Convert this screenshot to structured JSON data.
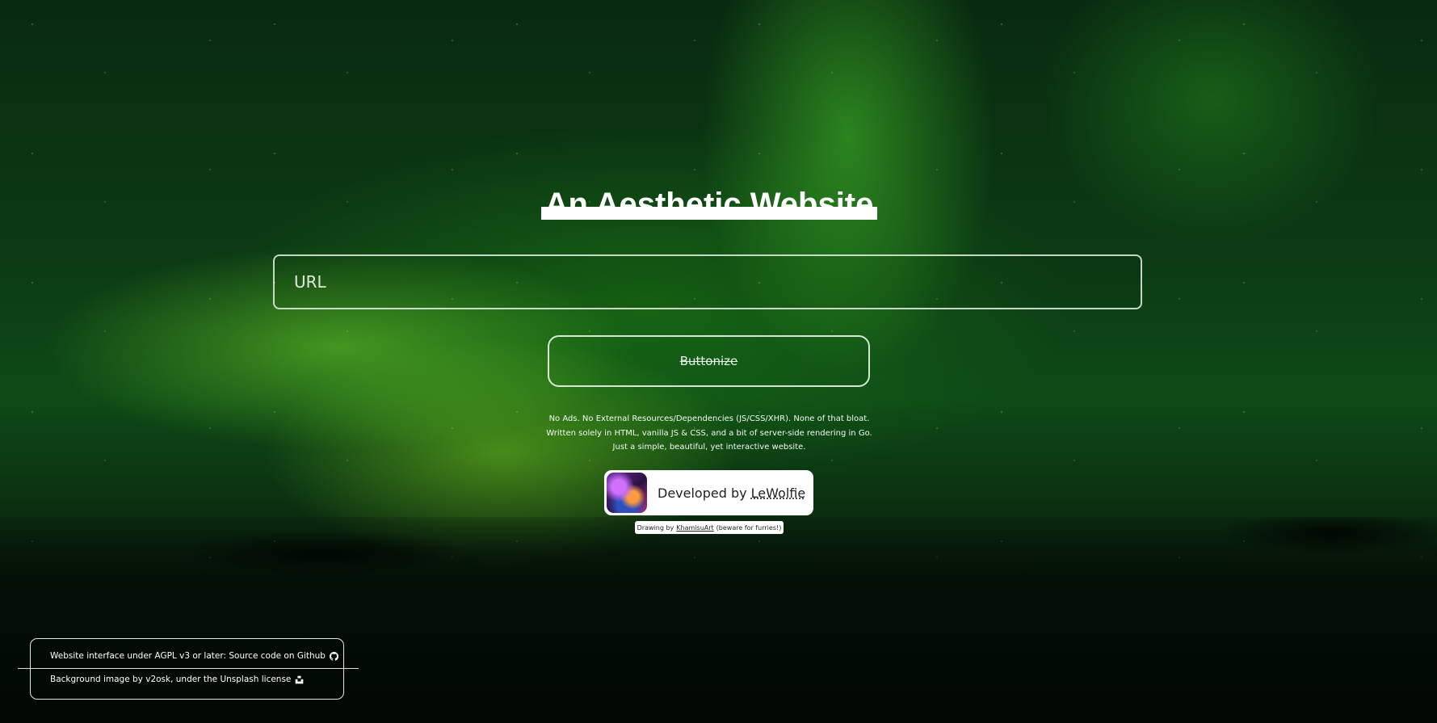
{
  "page": {
    "title": "An Aesthetic Website"
  },
  "form": {
    "url_placeholder": "URL",
    "submit_label": "Buttonize"
  },
  "blurb": {
    "line1": "No Ads. No External Resources/Dependencies (JS/CSS/XHR). None of that bloat.",
    "line2": "Written solely in HTML, vanilla JS & CSS, and a bit of server-side rendering in Go.",
    "line3": "Just a simple, beautiful, yet interactive website."
  },
  "developer": {
    "prefix": "Developed by",
    "name": "LeWolfie"
  },
  "drawing_credit": {
    "prefix": "Drawing by",
    "artist": "KhamisuArt",
    "suffix": "(beware for furries!)"
  },
  "footer": {
    "license_text": "Website interface under AGPL v3 or later: Source code on Github",
    "license_icon": "github-icon",
    "background_text": "Background image by v2osk, under the Unsplash license",
    "background_icon": "unsplash-icon"
  },
  "colors": {
    "text": "#ffffff",
    "card_bg": "#ffffff",
    "card_text": "#222222",
    "background_green": "#0e4a16"
  }
}
